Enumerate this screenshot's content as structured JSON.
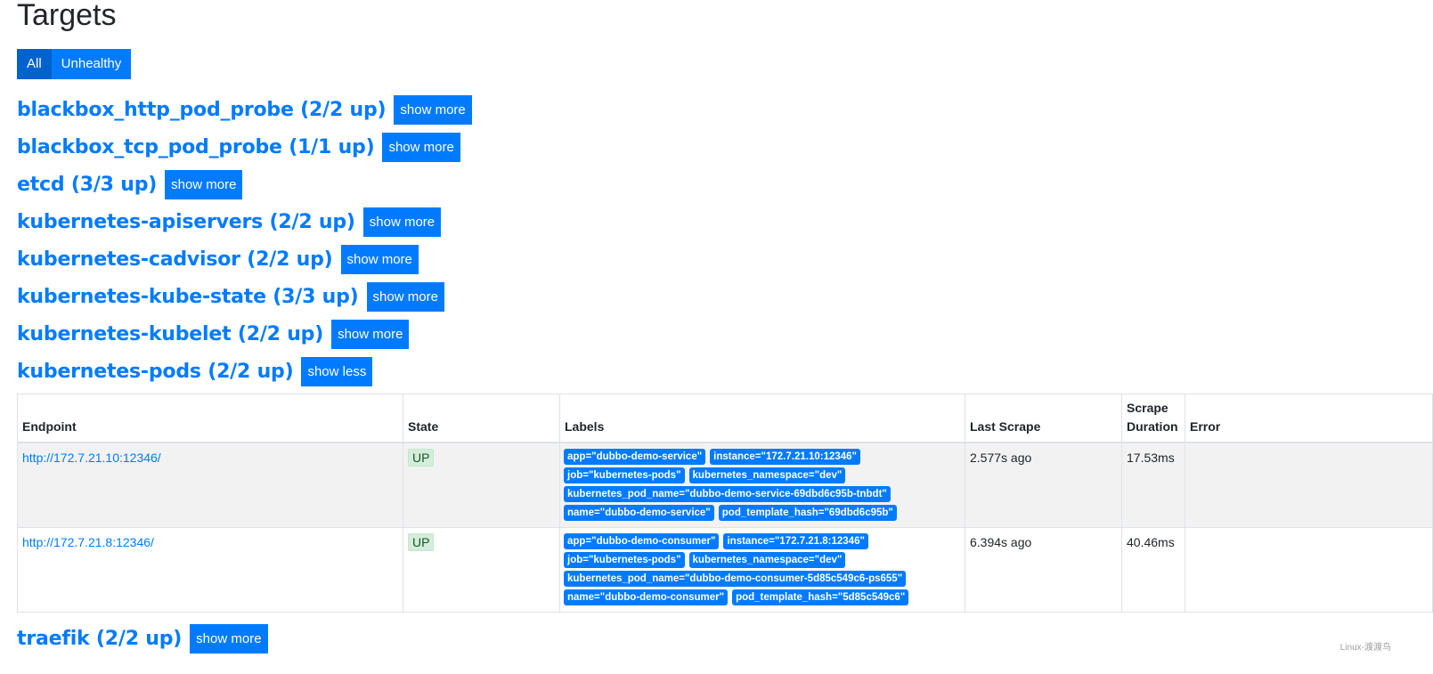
{
  "page": {
    "title": "Targets"
  },
  "filters": [
    {
      "label": "All",
      "active": true
    },
    {
      "label": "Unhealthy",
      "active": false
    }
  ],
  "jobs": [
    {
      "title": "blackbox_http_pod_probe (2/2 up)",
      "toggle": "show more"
    },
    {
      "title": "blackbox_tcp_pod_probe (1/1 up)",
      "toggle": "show more"
    },
    {
      "title": "etcd (3/3 up)",
      "toggle": "show more"
    },
    {
      "title": "kubernetes-apiservers (2/2 up)",
      "toggle": "show more"
    },
    {
      "title": "kubernetes-cadvisor (2/2 up)",
      "toggle": "show more"
    },
    {
      "title": "kubernetes-kube-state (3/3 up)",
      "toggle": "show more"
    },
    {
      "title": "kubernetes-kubelet (2/2 up)",
      "toggle": "show more"
    },
    {
      "title": "kubernetes-pods (2/2 up)",
      "toggle": "show less"
    },
    {
      "title": "traefik (2/2 up)",
      "toggle": "show more"
    }
  ],
  "table": {
    "headers": {
      "endpoint": "Endpoint",
      "state": "State",
      "labels": "Labels",
      "last_scrape": "Last Scrape",
      "scrape_duration_line1": "Scrape",
      "scrape_duration_line2": "Duration",
      "error": "Error"
    },
    "rows": [
      {
        "endpoint": "http://172.7.21.10:12346/",
        "state": "UP",
        "labels": [
          [
            "app=\"dubbo-demo-service\"",
            "instance=\"172.7.21.10:12346\""
          ],
          [
            "job=\"kubernetes-pods\"",
            "kubernetes_namespace=\"dev\""
          ],
          [
            "kubernetes_pod_name=\"dubbo-demo-service-69dbd6c95b-tnbdt\""
          ],
          [
            "name=\"dubbo-demo-service\"",
            "pod_template_hash=\"69dbd6c95b\""
          ]
        ],
        "last_scrape": "2.577s ago",
        "scrape_duration": "17.53ms",
        "error": ""
      },
      {
        "endpoint": "http://172.7.21.8:12346/",
        "state": "UP",
        "labels": [
          [
            "app=\"dubbo-demo-consumer\"",
            "instance=\"172.7.21.8:12346\""
          ],
          [
            "job=\"kubernetes-pods\"",
            "kubernetes_namespace=\"dev\""
          ],
          [
            "kubernetes_pod_name=\"dubbo-demo-consumer-5d85c549c6-ps655\""
          ],
          [
            "name=\"dubbo-demo-consumer\"",
            "pod_template_hash=\"5d85c549c6\""
          ]
        ],
        "last_scrape": "6.394s ago",
        "scrape_duration": "40.46ms",
        "error": ""
      }
    ]
  },
  "watermark": "Linux-渡渡鸟",
  "colors": {
    "primary": "#007bff",
    "primary_active": "#0062cc",
    "up_badge_bg": "#d4edda",
    "up_badge_text": "#155724"
  }
}
